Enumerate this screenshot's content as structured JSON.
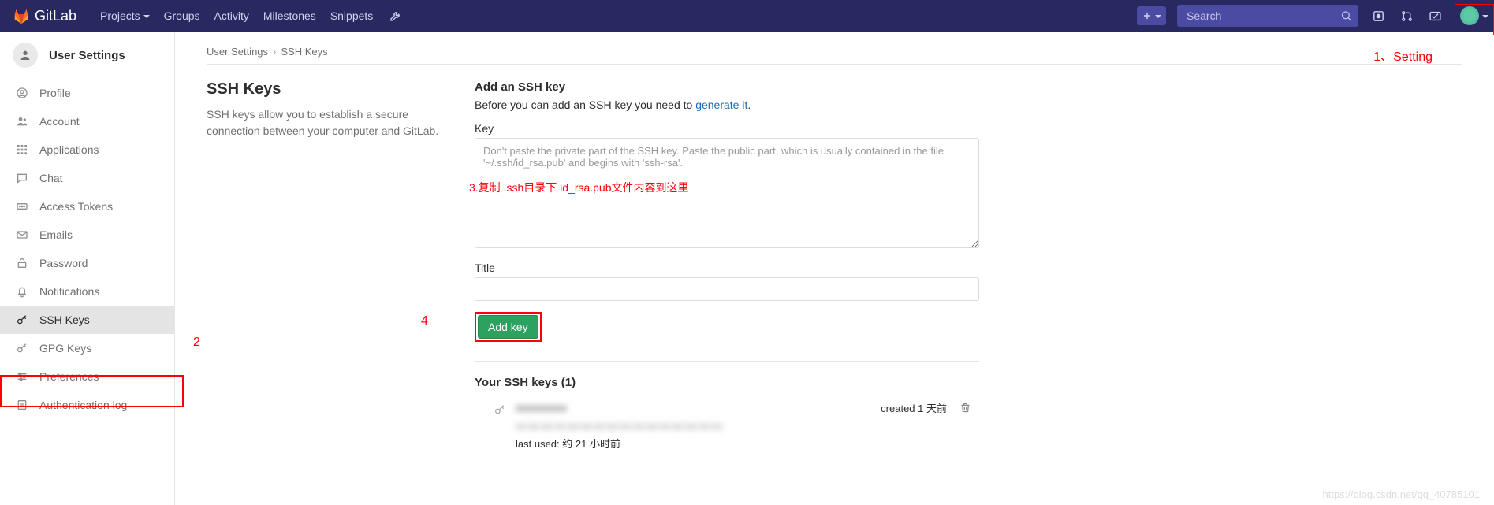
{
  "header": {
    "brand": "GitLab",
    "nav": {
      "projects": "Projects",
      "groups": "Groups",
      "activity": "Activity",
      "milestones": "Milestones",
      "snippets": "Snippets"
    },
    "search_placeholder": "Search"
  },
  "sidebar": {
    "title": "User Settings",
    "items": {
      "profile": "Profile",
      "account": "Account",
      "applications": "Applications",
      "chat": "Chat",
      "access_tokens": "Access Tokens",
      "emails": "Emails",
      "password": "Password",
      "notifications": "Notifications",
      "ssh_keys": "SSH Keys",
      "gpg_keys": "GPG Keys",
      "preferences": "Preferences",
      "auth_log": "Authentication log"
    }
  },
  "breadcrumb": {
    "a": "User Settings",
    "b": "SSH Keys"
  },
  "left": {
    "title": "SSH Keys",
    "desc": "SSH keys allow you to establish a secure connection between your computer and GitLab."
  },
  "form": {
    "add_title": "Add an SSH key",
    "hint_pre": "Before you can add an SSH key you need to ",
    "hint_link": "generate it",
    "hint_post": ".",
    "key_label": "Key",
    "key_placeholder": "Don't paste the private part of the SSH key. Paste the public part, which is usually contained in the file '~/.ssh/id_rsa.pub' and begins with 'ssh-rsa'.",
    "title_label": "Title",
    "add_btn": "Add key"
  },
  "keys": {
    "heading": "Your SSH keys (1)",
    "row": {
      "title_blur": "xxxxxxxxx",
      "fp_blur": "xx:xx:xx:xx:xx:xx:xx:xx:xx:xx:xx:xx:xx:xx:xx:xx",
      "last_used": "last used: 约 21 小时前",
      "created": "created 1 天前"
    }
  },
  "annotations": {
    "setting": "1、Setting",
    "n2": "2",
    "n3": "3.复制 .ssh目录下 id_rsa.pub文件内容到这里",
    "n4": "4"
  },
  "watermark": "https://blog.csdn.net/qq_40785101"
}
